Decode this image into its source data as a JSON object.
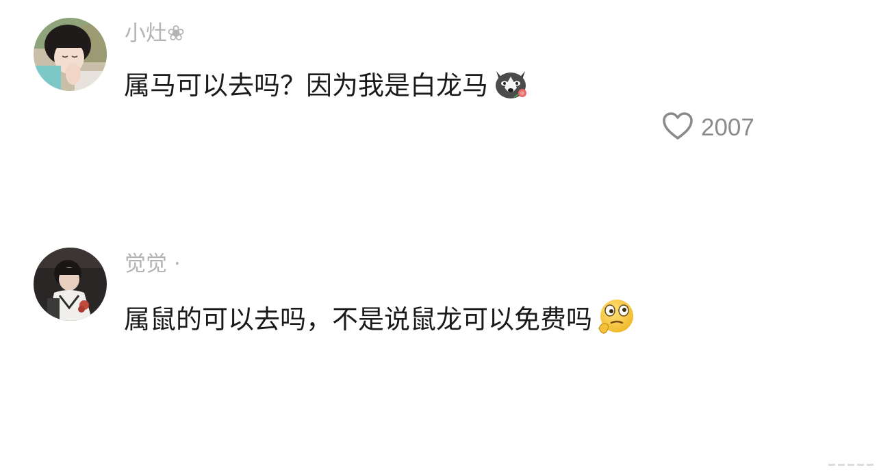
{
  "comments": [
    {
      "username": "小灶❀",
      "text": "属马可以去吗？因为我是白龙马",
      "emoji": "husky-rose-emoji",
      "likes": "2007"
    },
    {
      "username": "觉觉 ·",
      "text": "属鼠的可以去吗，不是说鼠龙可以免费吗",
      "emoji": "thinking-eyes-emoji"
    }
  ],
  "icons": {
    "like": "heart-outline-icon"
  },
  "colors": {
    "username": "#b3b3b3",
    "text": "#1a1a1a",
    "like": "#808080"
  }
}
